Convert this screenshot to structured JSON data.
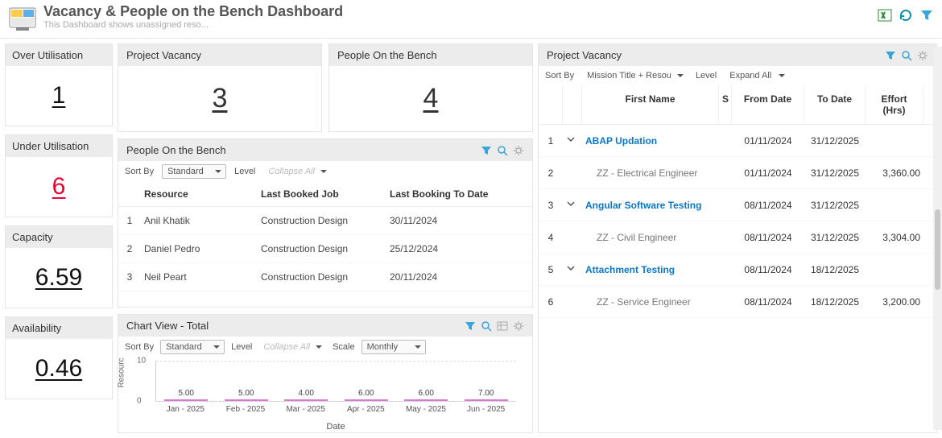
{
  "header": {
    "title": "Vacancy & People on the Bench Dashboard",
    "subtitle": "This Dashboard shows unassigned reso..."
  },
  "kpis": {
    "over_util": {
      "label": "Over Utilisation",
      "value": "1"
    },
    "under_util": {
      "label": "Under Utilisation",
      "value": "6"
    },
    "capacity": {
      "label": "Capacity",
      "value": "6.59"
    },
    "availability": {
      "label": "Availability",
      "value": "0.46"
    }
  },
  "mid_top": {
    "project_vacancy": {
      "label": "Project Vacancy",
      "value": "3"
    },
    "people_bench": {
      "label": "People On the Bench",
      "value": "4"
    }
  },
  "bench": {
    "title": "People On the Bench",
    "sort_by_label": "Sort By",
    "sort_by_value": "Standard",
    "level_label": "Level",
    "collapse_label": "Collapse All",
    "cols": {
      "resource": "Resource",
      "last_job": "Last Booked Job",
      "last_to": "Last Booking To Date"
    },
    "rows": [
      {
        "i": "1",
        "resource": "Anil Khatik",
        "job": "Construction Design",
        "date": "30/11/2024"
      },
      {
        "i": "2",
        "resource": "Daniel Pedro",
        "job": "Construction Design",
        "date": "25/12/2024"
      },
      {
        "i": "3",
        "resource": "Neil Peart",
        "job": "Construction Design",
        "date": "20/11/2024"
      }
    ]
  },
  "chart": {
    "title": "Chart View - Total",
    "sort_by_label": "Sort By",
    "sort_by_value": "Standard",
    "level_label": "Level",
    "collapse_label": "Collapse All",
    "scale_label": "Scale",
    "scale_value": "Monthly",
    "xtitle": "Date",
    "ylabel": "Resourc"
  },
  "chart_data": {
    "type": "bar",
    "categories": [
      "Jan - 2025",
      "Feb - 2025",
      "Mar - 2025",
      "Apr - 2025",
      "May - 2025",
      "Jun - 2025"
    ],
    "values": [
      5.0,
      5.0,
      4.0,
      6.0,
      6.0,
      7.0
    ],
    "value_labels": [
      "5.00",
      "5.00",
      "4.00",
      "6.00",
      "6.00",
      "7.00"
    ],
    "ylim": [
      0,
      10
    ],
    "yticks": [
      0,
      10
    ],
    "xlabel": "Date",
    "ylabel": "Resources"
  },
  "pv": {
    "title": "Project Vacancy",
    "sort_by_label": "Sort By",
    "sort_by_value": "Mission Title + Resou",
    "level_label": "Level",
    "expand_label": "Expand All",
    "cols": {
      "name": "First Name",
      "from": "From Date",
      "to": "To Date",
      "effort": "Effort (Hrs)"
    },
    "rows": [
      {
        "i": "1",
        "exp": true,
        "name": "ABAP Updation",
        "from": "01/11/2024",
        "to": "31/12/2025",
        "eff": "",
        "link": true
      },
      {
        "i": "2",
        "exp": false,
        "name": "ZZ - Electrical Engineer",
        "from": "01/11/2024",
        "to": "31/12/2025",
        "eff": "3,360.00",
        "link": false
      },
      {
        "i": "3",
        "exp": true,
        "name": "Angular Software Testing",
        "from": "08/11/2024",
        "to": "31/12/2025",
        "eff": "",
        "link": true
      },
      {
        "i": "4",
        "exp": false,
        "name": "ZZ - Civil Engineer",
        "from": "08/11/2024",
        "to": "31/12/2025",
        "eff": "3,304.00",
        "link": false
      },
      {
        "i": "5",
        "exp": true,
        "name": "Attachment Testing",
        "from": "08/11/2024",
        "to": "18/12/2025",
        "eff": "",
        "link": true
      },
      {
        "i": "6",
        "exp": false,
        "name": "ZZ - Service Engineer",
        "from": "08/11/2024",
        "to": "18/12/2025",
        "eff": "3,200.00",
        "link": false
      }
    ]
  }
}
